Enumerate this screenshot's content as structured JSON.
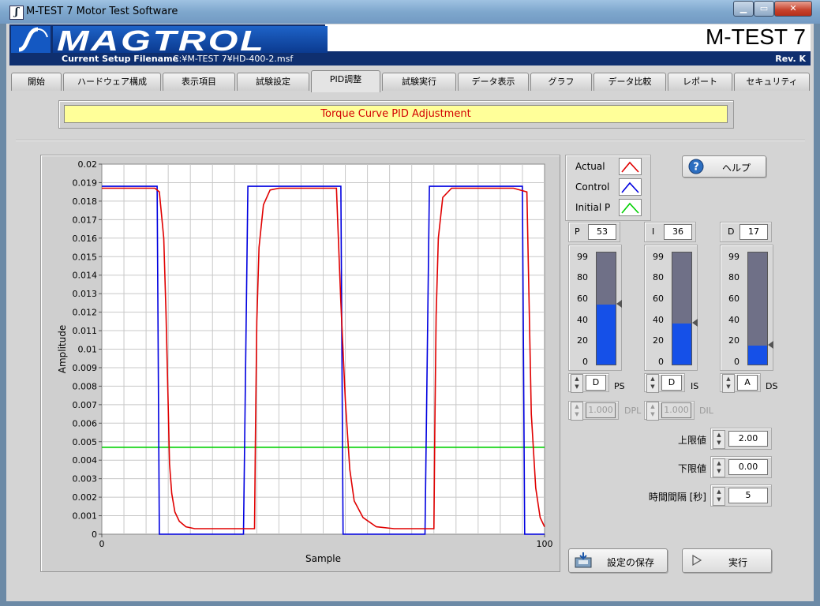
{
  "window": {
    "title": "M-TEST 7 Motor Test Software",
    "min_icon": "minimize-icon",
    "max_icon": "maximize-icon",
    "close_icon": "close-icon"
  },
  "header": {
    "logo": "MAGTROL",
    "product": "M-TEST 7",
    "setup_label": "Current Setup Filename",
    "setup_value": "C:¥M-TEST 7¥HD-400-2.msf",
    "revision": "Rev. K"
  },
  "tabs": [
    {
      "label": "開始"
    },
    {
      "label": "ハードウェア構成"
    },
    {
      "label": "表示項目"
    },
    {
      "label": "試験設定"
    },
    {
      "label": "PID調整"
    },
    {
      "label": "試験実行"
    },
    {
      "label": "データ表示"
    },
    {
      "label": "グラフ"
    },
    {
      "label": "データ比較"
    },
    {
      "label": "レポート"
    },
    {
      "label": "セキュリティ"
    }
  ],
  "active_tab": 4,
  "banner": {
    "text": "Torque Curve PID Adjustment"
  },
  "legend": {
    "items": [
      {
        "label": "Actual",
        "color": "#e00000"
      },
      {
        "label": "Control",
        "color": "#0000e0"
      },
      {
        "label": "Initial P",
        "color": "#00d000"
      }
    ]
  },
  "pid": {
    "p": {
      "label": "P",
      "value": "53",
      "level": 53,
      "scale_mode": "D",
      "scale_label": "PS"
    },
    "i": {
      "label": "I",
      "value": "36",
      "level": 36,
      "scale_mode": "D",
      "scale_label": "IS"
    },
    "d": {
      "label": "D",
      "value": "17",
      "level": 17,
      "scale_mode": "A",
      "scale_label": "DS"
    },
    "scale_ticks": [
      "99",
      "80",
      "60",
      "40",
      "20",
      "0"
    ],
    "dpl": {
      "label": "DPL",
      "value": "1.000"
    },
    "dil": {
      "label": "DIL",
      "value": "1.000"
    }
  },
  "limits": {
    "upper": {
      "label": "上限値",
      "value": "2.00"
    },
    "lower": {
      "label": "下限値",
      "value": "0.00"
    },
    "interval": {
      "label": "時間間隔 [秒]",
      "value": "5"
    }
  },
  "buttons": {
    "help": {
      "label": "ヘルプ",
      "icon": "help-icon"
    },
    "save": {
      "label": "設定の保存",
      "icon": "save-icon"
    },
    "run": {
      "label": "実行",
      "icon": "play-icon"
    }
  },
  "chart_data": {
    "type": "line",
    "xlabel": "Sample",
    "ylabel": "Amplitude",
    "xlim": [
      0,
      100
    ],
    "ylim": [
      0,
      0.02
    ],
    "x_ticks": [
      "0",
      "100"
    ],
    "y_ticks": [
      "0",
      "0.001",
      "0.002",
      "0.003",
      "0.004",
      "0.005",
      "0.006",
      "0.007",
      "0.008",
      "0.009",
      "0.01",
      "0.011",
      "0.012",
      "0.013",
      "0.014",
      "0.015",
      "0.016",
      "0.017",
      "0.018",
      "0.019",
      "0.02"
    ],
    "grid": true,
    "series": [
      {
        "name": "Actual",
        "color": "#e00000",
        "x": [
          0,
          12,
          13,
          14,
          14.5,
          15,
          15.3,
          15.8,
          16.5,
          17.5,
          19,
          21,
          26,
          31,
          34.5,
          34.7,
          35,
          35.5,
          36.5,
          38,
          40,
          44,
          53,
          53.3,
          54,
          55,
          56,
          57,
          59,
          62,
          66,
          70,
          75,
          75.2,
          75.5,
          76,
          77,
          79,
          82,
          86,
          93,
          96,
          97,
          98,
          99,
          100
        ],
        "y": [
          0.0187,
          0.0187,
          0.0185,
          0.016,
          0.012,
          0.007,
          0.0038,
          0.0022,
          0.0012,
          0.0007,
          0.0004,
          0.0003,
          0.0003,
          0.0003,
          0.0003,
          0.0055,
          0.0115,
          0.0155,
          0.0178,
          0.0186,
          0.0187,
          0.0187,
          0.0187,
          0.0168,
          0.0125,
          0.0072,
          0.0035,
          0.0018,
          0.0009,
          0.0004,
          0.0003,
          0.0003,
          0.0003,
          0.0055,
          0.0118,
          0.016,
          0.0182,
          0.0187,
          0.0187,
          0.0187,
          0.0187,
          0.0185,
          0.0065,
          0.0025,
          0.0009,
          0.0004
        ]
      },
      {
        "name": "Control",
        "color": "#0000e0",
        "x": [
          0,
          11.5,
          12.5,
          13,
          32,
          33,
          33.5,
          53,
          54,
          54.5,
          73,
          74,
          74.5,
          94,
          95,
          95.5,
          100
        ],
        "y": [
          0.0188,
          0.0188,
          0.0188,
          0,
          0,
          0.0188,
          0.0188,
          0.0188,
          0.0188,
          0,
          0,
          0.0188,
          0.0188,
          0.0188,
          0.0188,
          0,
          0
        ]
      },
      {
        "name": "Initial P",
        "color": "#00d000",
        "x": [
          0,
          100
        ],
        "y": [
          0.0047,
          0.0047
        ]
      }
    ]
  }
}
